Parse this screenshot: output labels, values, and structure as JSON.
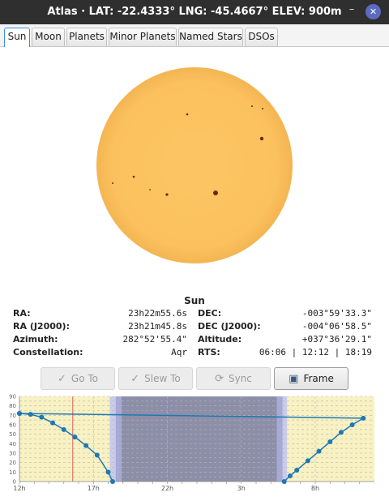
{
  "window": {
    "title": "Atlas · LAT: -22.4333° LNG: -45.4667° ELEV: 900m",
    "minimize_glyph": "–",
    "close_glyph": "✕"
  },
  "tabs": [
    {
      "label": "Sun",
      "active": true
    },
    {
      "label": "Moon",
      "active": false
    },
    {
      "label": "Planets",
      "active": false
    },
    {
      "label": "Minor Planets",
      "active": false
    },
    {
      "label": "Named Stars",
      "active": false
    },
    {
      "label": "DSOs",
      "active": false
    }
  ],
  "sun_image": {
    "disk_color": "#fbc15e",
    "spot_color": "#6a2a10"
  },
  "info": {
    "title": "Sun",
    "ra_label": "RA:",
    "ra_value": "23h22m55.6s",
    "dec_label": "DEC:",
    "dec_value": "-003°59'33.3\"",
    "raj_label": "RA (J2000):",
    "raj_value": "23h21m45.8s",
    "decj_label": "DEC (J2000):",
    "decj_value": "-004°06'58.5\"",
    "az_label": "Azimuth:",
    "az_value": "282°52'55.4\"",
    "alt_label": "Altitude:",
    "alt_value": "+037°36'29.1\"",
    "const_label": "Constellation:",
    "const_value": "Aqr",
    "rts_label": "RTS:",
    "rts_value": "06:06 | 12:12 | 18:19"
  },
  "buttons": [
    {
      "label": "Go To",
      "icon": "check-icon",
      "glyph": "✓",
      "enabled": false
    },
    {
      "label": "Slew To",
      "icon": "check-icon",
      "glyph": "✓",
      "enabled": false
    },
    {
      "label": "Sync",
      "icon": "sync-icon",
      "glyph": "⟳",
      "enabled": false
    },
    {
      "label": "Frame",
      "icon": "image-icon",
      "glyph": "▣",
      "enabled": true
    }
  ],
  "chart_data": {
    "type": "line",
    "title": "",
    "xlabel": "",
    "ylabel": "",
    "ylim": [
      0,
      90
    ],
    "y_ticks": [
      0,
      5,
      10,
      15,
      20,
      25,
      30,
      35,
      40,
      45,
      50,
      55,
      60,
      65,
      70,
      75,
      80,
      85,
      90
    ],
    "y_tick_labels": [
      "0",
      "",
      "10",
      "",
      "20",
      "",
      "30",
      "",
      "40",
      "",
      "50",
      "",
      "60",
      "",
      "70",
      "",
      "80",
      "",
      "90"
    ],
    "x_tick_labels": [
      "12h",
      "17h",
      "22h",
      "3h",
      "8h"
    ],
    "x_hours": [
      12,
      12.75,
      13.5,
      14.25,
      15,
      15.75,
      16.5,
      17.25,
      18,
      18.3,
      5.9,
      6.3,
      6.75,
      7.5,
      8.25,
      9,
      9.75,
      10.5,
      11.25,
      12
    ],
    "altitude": [
      72,
      71,
      68,
      62,
      55,
      47,
      38,
      28,
      10,
      0,
      0,
      6,
      12,
      22,
      32,
      42,
      52,
      60,
      67,
      72
    ],
    "current_time_h": 15.6,
    "bands": [
      {
        "name": "day",
        "color": "#f8f1c2"
      },
      {
        "name": "civil",
        "color": "#c9cbe9"
      },
      {
        "name": "nautical",
        "color": "#a6a8d6"
      },
      {
        "name": "night",
        "color": "#8d8ea8"
      }
    ],
    "colors": {
      "line": "#1e78b4",
      "now": "#e07a6a",
      "grid": "#b8b8b8"
    }
  }
}
